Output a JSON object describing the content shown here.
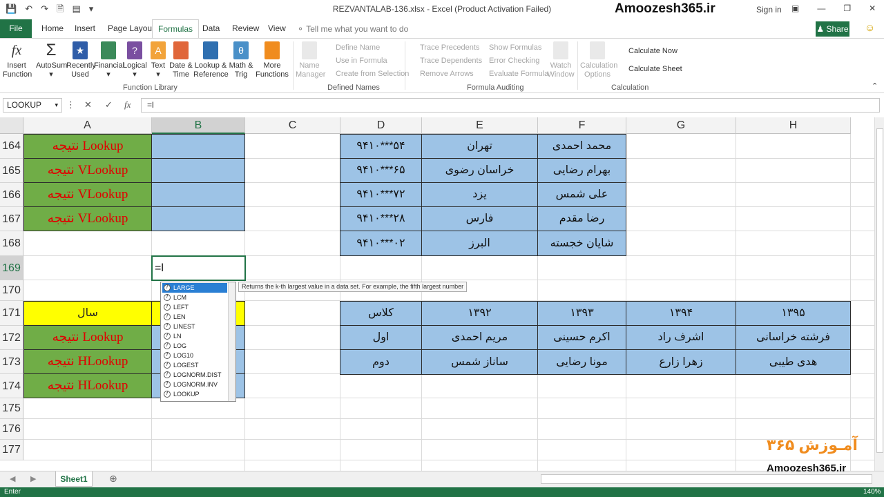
{
  "window": {
    "title": "REZVANTALAB-136.xlsx - Excel (Product Activation Failed)",
    "brand": "Amoozesh365.ir",
    "sign_in": "Sign in"
  },
  "tabs": [
    "File",
    "Home",
    "Insert",
    "Page Layout",
    "Formulas",
    "Data",
    "Review",
    "View"
  ],
  "tell_me": "Tell me what you want to do",
  "share": "Share",
  "ribbon": {
    "function_library": {
      "label": "Function Library",
      "insert_function": [
        "Insert",
        "Function"
      ],
      "autosum": "AutoSum",
      "recently_used": [
        "Recently",
        "Used"
      ],
      "financial": "Financial",
      "logical": "Logical",
      "text": "Text",
      "date_time": [
        "Date &",
        "Time"
      ],
      "lookup_reference": [
        "Lookup &",
        "Reference"
      ],
      "math_trig": [
        "Math &",
        "Trig"
      ],
      "more_functions": [
        "More",
        "Functions"
      ]
    },
    "defined_names": {
      "label": "Defined Names",
      "name_manager": [
        "Name",
        "Manager"
      ],
      "define_name": "Define Name",
      "use_in_formula": "Use in Formula",
      "create_from_selection": "Create from Selection"
    },
    "formula_auditing": {
      "label": "Formula Auditing",
      "trace_precedents": "Trace Precedents",
      "trace_dependents": "Trace Dependents",
      "remove_arrows": "Remove Arrows",
      "show_formulas": "Show Formulas",
      "error_checking": "Error Checking",
      "evaluate_formula": "Evaluate Formula",
      "watch_window": [
        "Watch",
        "Window"
      ]
    },
    "calculation": {
      "label": "Calculation",
      "calculation_options": [
        "Calculation",
        "Options"
      ],
      "calculate_now": "Calculate Now",
      "calculate_sheet": "Calculate Sheet"
    }
  },
  "formula_bar": {
    "name_box": "LOOKUP",
    "content": "=l"
  },
  "columns": [
    "A",
    "B",
    "C",
    "D",
    "E",
    "F",
    "G",
    "H"
  ],
  "rows": [
    "164",
    "165",
    "166",
    "167",
    "168",
    "169",
    "170",
    "171",
    "172",
    "173",
    "174",
    "175",
    "176",
    "177"
  ],
  "cells": {
    "a164": "نتیجه Lookup",
    "a165": "نتیجه VLookup",
    "a166": "نتیجه VLookup",
    "a167": "نتیجه VLookup",
    "a171": "سال",
    "a172": "نتیجه Lookup",
    "a173": "نتیجه HLookup",
    "a174": "نتیجه HLookup",
    "b169": "=l"
  },
  "table1": [
    [
      "۹۴۱۰***۵۴",
      "تهران",
      "محمد احمدی"
    ],
    [
      "۹۴۱۰***۶۵",
      "خراسان رضوی",
      "بهرام رضایی"
    ],
    [
      "۹۴۱۰***۷۲",
      "یزد",
      "علی شمس"
    ],
    [
      "۹۴۱۰***۲۸",
      "فارس",
      "رضا مقدم"
    ],
    [
      "۹۴۱۰***۰۲",
      "البرز",
      "شایان خجسته"
    ]
  ],
  "table2": [
    [
      "کلاس",
      "۱۳۹۲",
      "۱۳۹۳",
      "۱۳۹۴",
      "۱۳۹۵"
    ],
    [
      "اول",
      "مریم احمدی",
      "اکرم حسینی",
      "اشرف راد",
      "فرشته خراسانی"
    ],
    [
      "دوم",
      "ساناز شمس",
      "مونا رضایی",
      "زهرا زارع",
      "هدی طیبی"
    ]
  ],
  "autocomplete": {
    "items": [
      "LARGE",
      "LCM",
      "LEFT",
      "LEN",
      "LINEST",
      "LN",
      "LOG",
      "LOG10",
      "LOGEST",
      "LOGNORM.DIST",
      "LOGNORM.INV",
      "LOOKUP"
    ],
    "selected": "LARGE",
    "tooltip": "Returns the k-th largest value in a data set. For example, the fifth largest number"
  },
  "sheet_tab": "Sheet1",
  "status": {
    "mode": "Enter",
    "zoom": "140%"
  },
  "watermark": {
    "text": "Amoozesh365.ir",
    "fa": "آمـوزش ۳۶۵"
  },
  "colors": {
    "excel_green": "#217346",
    "cell_green": "#70ad47",
    "cell_blue": "#9dc3e6",
    "cell_yellow": "#ffff00",
    "lookup_red": "#e00000"
  }
}
